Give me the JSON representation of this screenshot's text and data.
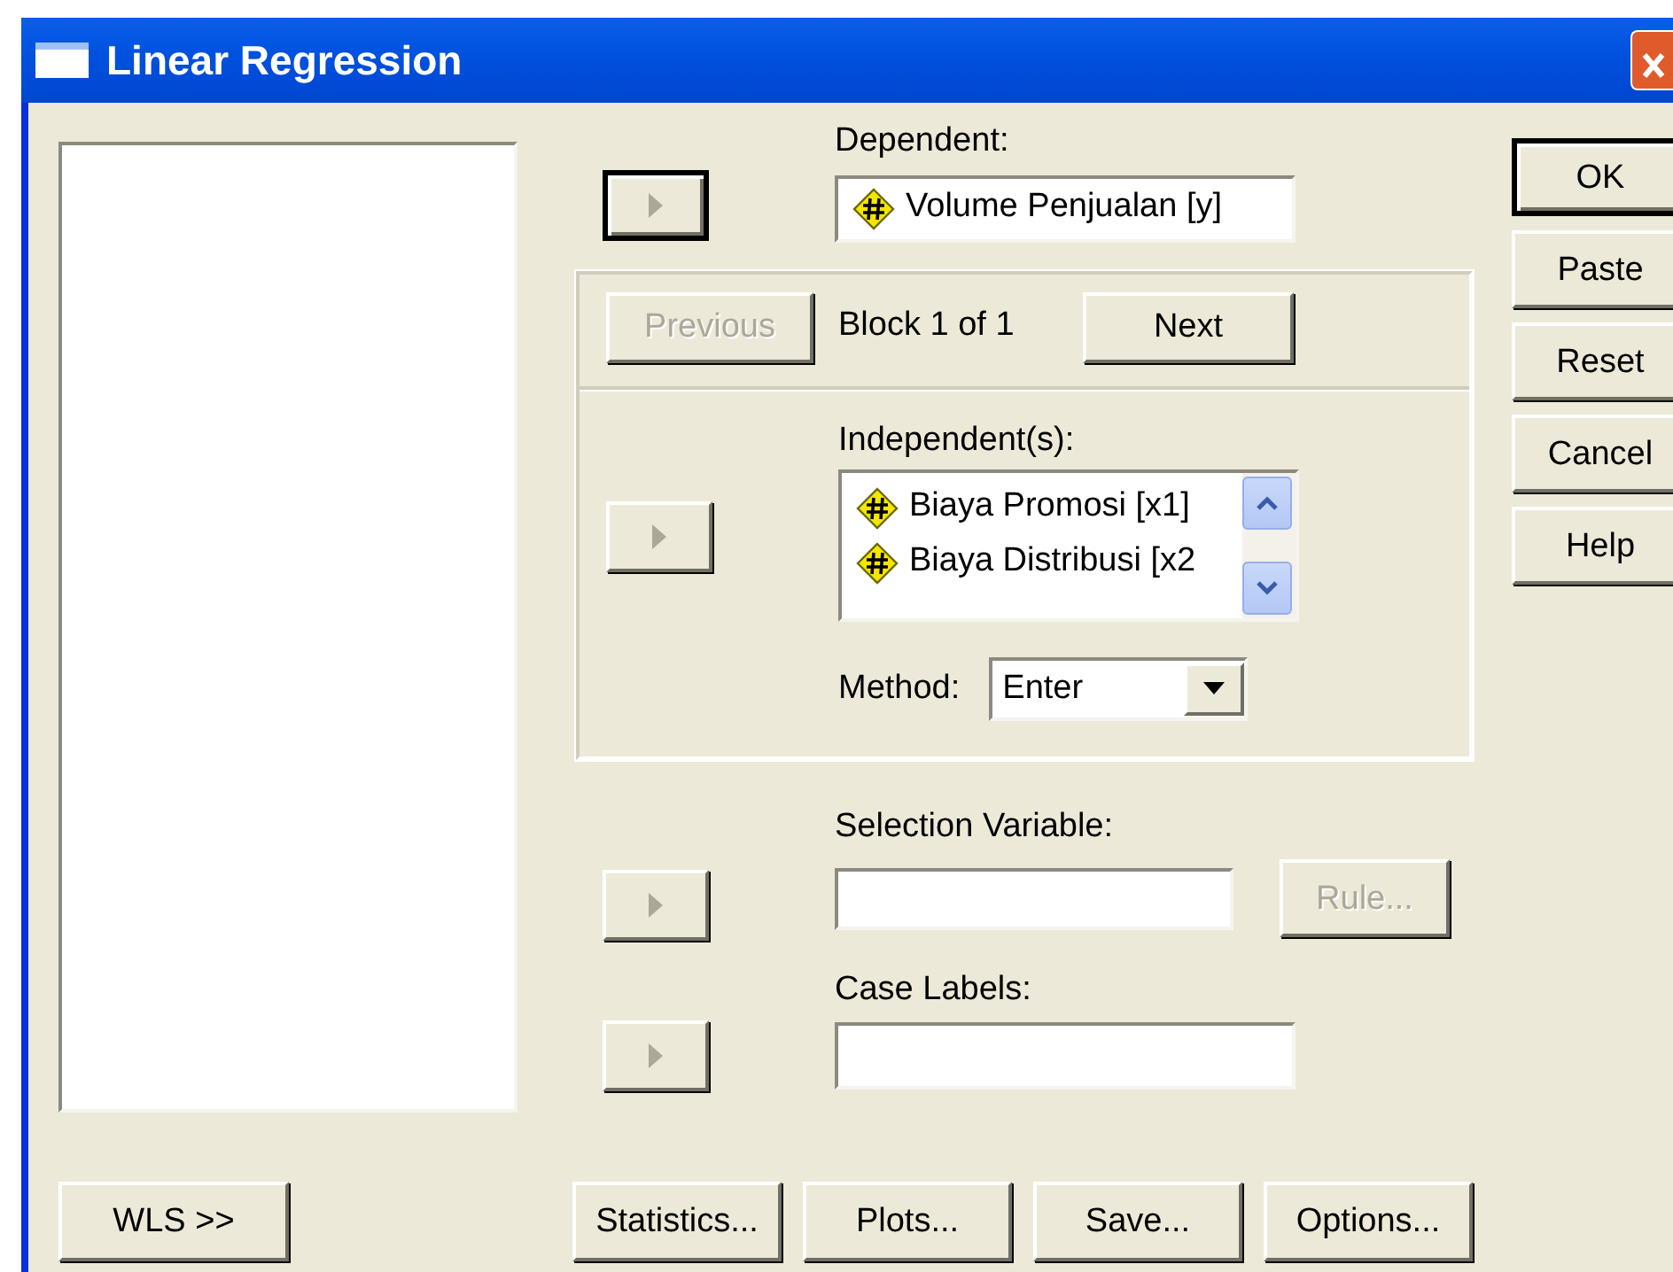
{
  "window": {
    "title": "Linear Regression"
  },
  "dependent": {
    "label": "Dependent:",
    "value": "Volume Penjualan [y]"
  },
  "block": {
    "previous": {
      "label": "Previous",
      "disabled": true
    },
    "status": "Block 1 of 1",
    "next": {
      "label": "Next",
      "disabled": false
    }
  },
  "independents": {
    "label": "Independent(s):",
    "items": [
      "Biaya Promosi [x1]",
      "Biaya Distribusi [x2"
    ]
  },
  "method": {
    "label": "Method:",
    "value": "Enter"
  },
  "selection_variable": {
    "label": "Selection Variable:",
    "rule_button": {
      "label": "Rule...",
      "disabled": true
    }
  },
  "case_labels": {
    "label": "Case Labels:"
  },
  "transfer_buttons": [
    {
      "default": true
    },
    {
      "default": false
    },
    {
      "default": false
    },
    {
      "default": false
    }
  ],
  "side_buttons": [
    {
      "label": "OK",
      "default": true
    },
    {
      "label": "Paste",
      "default": false
    },
    {
      "label": "Reset",
      "default": false
    },
    {
      "label": "Cancel",
      "default": false
    },
    {
      "label": "Help",
      "default": false
    }
  ],
  "wls_button": "WLS >>",
  "bottom_buttons": [
    "Statistics...",
    "Plots...",
    "Save...",
    "Options..."
  ]
}
